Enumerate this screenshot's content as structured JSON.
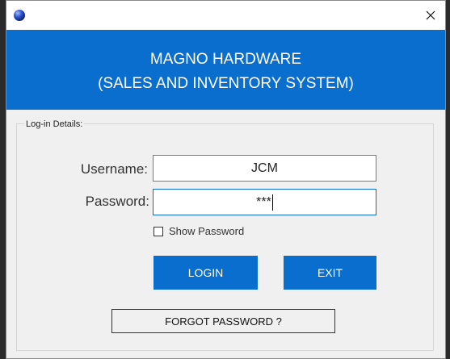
{
  "window": {
    "close_glyph": "✕"
  },
  "header": {
    "line1": "MAGNO HARDWARE",
    "line2": "(SALES AND INVENTORY SYSTEM)",
    "color": "#0a6ece"
  },
  "login": {
    "group_label": "Log-in Details:",
    "username_label": "Username:",
    "username_value": "JCM",
    "password_label": "Password:",
    "password_value": "***",
    "show_password_label": "Show Password",
    "show_password_checked": false,
    "login_button": "LOGIN",
    "exit_button": "EXIT",
    "forgot_button": "FORGOT PASSWORD ?"
  },
  "icons": {
    "app": "app-globe-icon",
    "close": "close-icon"
  }
}
